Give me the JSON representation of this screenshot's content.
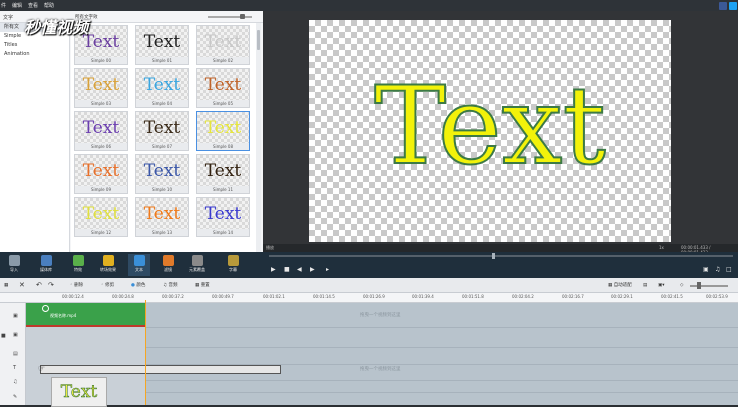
{
  "menu": {
    "items": [
      "件",
      "编辑",
      "查看",
      "帮助"
    ]
  },
  "left_panel": {
    "header": "文字",
    "tree_header": "所有文",
    "tree": [
      "Simple",
      "Titles",
      "Animation"
    ],
    "grid_header": "所有文字效",
    "tiles": [
      {
        "text": "Text",
        "caption": "Simple 00",
        "color": "#6b3fa0"
      },
      {
        "text": "Text",
        "caption": "Simple 01",
        "color": "#222222"
      },
      {
        "text": "Text",
        "caption": "Simple 02",
        "color": "#c8c8c8"
      },
      {
        "text": "Text",
        "caption": "Simple 03",
        "color": "#d9a23a"
      },
      {
        "text": "Text",
        "caption": "Simple 04",
        "color": "#3aa6e0"
      },
      {
        "text": "Text",
        "caption": "Simple 05",
        "color": "#c0642a"
      },
      {
        "text": "Text",
        "caption": "Simple 06",
        "color": "#6c3fb0"
      },
      {
        "text": "Text",
        "caption": "Simple 07",
        "color": "#3a2a18"
      },
      {
        "text": "Text",
        "caption": "Simple 08",
        "color": "#e6e63a"
      },
      {
        "text": "Text",
        "caption": "Simple 09",
        "color": "#e8702a"
      },
      {
        "text": "Text",
        "caption": "Simple 10",
        "color": "#3a56a8"
      },
      {
        "text": "Text",
        "caption": "Simple 11",
        "color": "#332211"
      },
      {
        "text": "Text",
        "caption": "Simple 12",
        "color": "#e0e040"
      },
      {
        "text": "Text",
        "caption": "Simple 13",
        "color": "#f07a1a"
      },
      {
        "text": "Text",
        "caption": "Simple 14",
        "color": "#3a3ad0"
      }
    ]
  },
  "preview": {
    "text": "Text",
    "text_color": "#f2f20a",
    "outline_color": "#3c7a45",
    "label": "播放",
    "zoom": "1x",
    "timecode": "00:00:01.433 / 00:00:01.433"
  },
  "watermark": "秒懂视频",
  "toolbar": [
    "导入",
    "媒体库",
    "特效",
    "转场效果",
    "文本",
    "滤镜",
    "元素覆盖",
    "字幕"
  ],
  "timeline": {
    "tools": [
      "删除",
      "修剪",
      "颜色",
      "音频",
      "重置"
    ],
    "zoom_label": "自动适配",
    "ticks": [
      "00:00:12.4",
      "00:00:24.8",
      "00:00:37.2",
      "00:00:49.7",
      "00:01:02.1",
      "00:01:14.5",
      "00:01:26.9",
      "00:01:39.4",
      "00:01:51.8",
      "00:02:04.2",
      "00:02:16.7",
      "00:02:29.1",
      "00:02:41.5",
      "00:02:53.9"
    ],
    "clip_name": "视频名称.mp4",
    "hint_video": "拖曳一个视频到这里",
    "hint_text": "拖曳一个视频到这里",
    "thumb_text": "Text"
  }
}
